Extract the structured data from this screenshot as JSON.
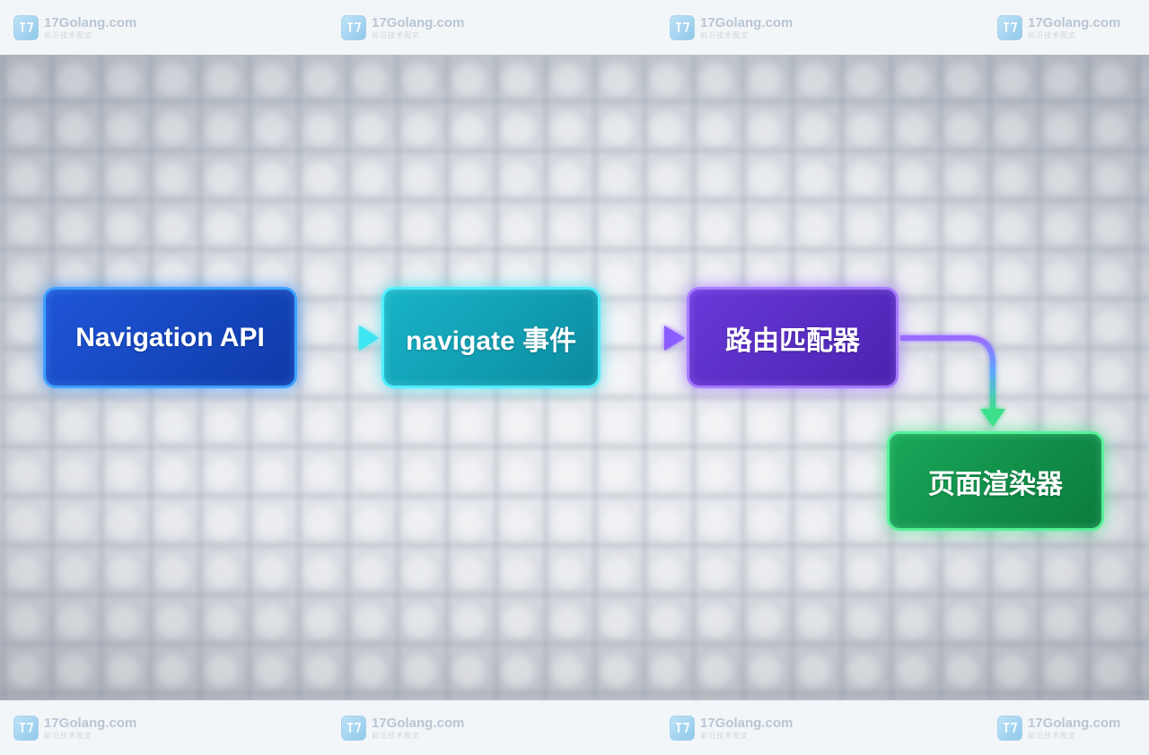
{
  "watermark": {
    "name": "17Golang.com",
    "subtitle": "前沿技术图文"
  },
  "nodes": {
    "navigation_api": "Navigation API",
    "navigate_event": "navigate 事件",
    "router_matcher": "路由匹配器",
    "page_renderer": "页面渲染器"
  },
  "colors": {
    "navigation_api": "#1f56d8",
    "navigate_event": "#19b4c8",
    "router_matcher": "#6a39d9",
    "page_renderer": "#19a85a"
  }
}
